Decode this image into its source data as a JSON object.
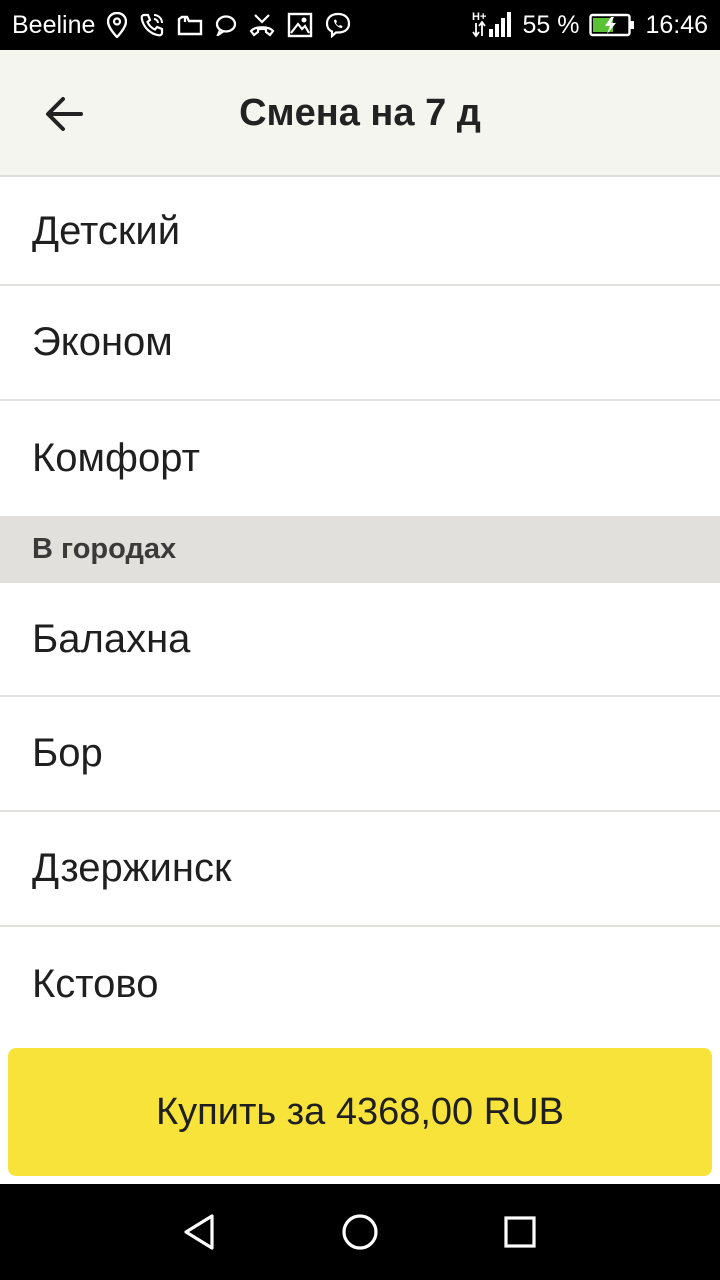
{
  "status_bar": {
    "carrier": "Beeline",
    "network_type": "H+",
    "battery_percent": "55 %",
    "time": "16:46",
    "icons": [
      "location-icon",
      "call-icon",
      "folder-icon",
      "chat-icon",
      "missed-call-icon",
      "image-icon",
      "viber-icon",
      "signal-icon",
      "battery-icon"
    ]
  },
  "header": {
    "title": "Смена на 7 д",
    "back_icon": "arrow-left-icon"
  },
  "list": {
    "tariffs": [
      {
        "label": "Детский"
      },
      {
        "label": "Эконом"
      },
      {
        "label": "Комфорт"
      }
    ],
    "section_title": "В городах",
    "cities": [
      {
        "label": "Балахна"
      },
      {
        "label": "Бор"
      },
      {
        "label": "Дзержинск"
      },
      {
        "label": "Кстово"
      }
    ]
  },
  "buy_button": {
    "label": "Купить за 4368,00 RUB",
    "color": "#f7e33a"
  },
  "nav_bar": {
    "icons": [
      "back-triangle-icon",
      "home-circle-icon",
      "recents-square-icon"
    ]
  }
}
